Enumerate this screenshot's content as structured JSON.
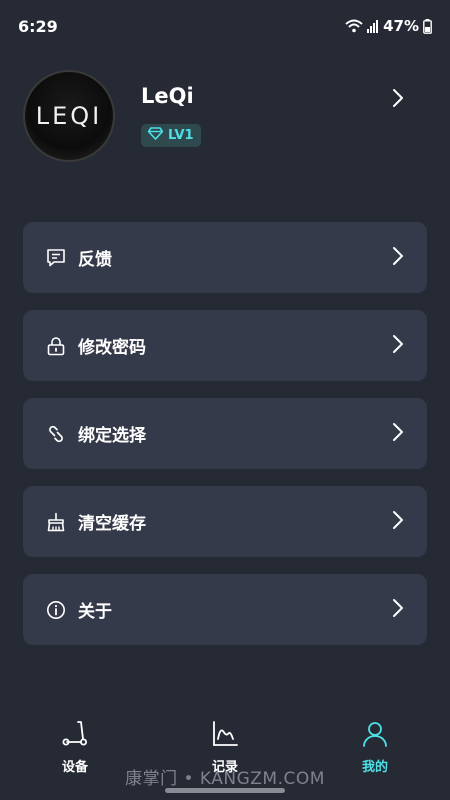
{
  "status_bar": {
    "time": "6:29",
    "battery": "47%"
  },
  "profile": {
    "avatar_text": "LEQI",
    "name": "LeQi",
    "level": "LV1"
  },
  "menu": [
    {
      "label": "反馈",
      "icon": "feedback-icon"
    },
    {
      "label": "修改密码",
      "icon": "lock-icon"
    },
    {
      "label": "绑定选择",
      "icon": "link-icon"
    },
    {
      "label": "清空缓存",
      "icon": "broom-icon"
    },
    {
      "label": "关于",
      "icon": "info-icon"
    }
  ],
  "nav": {
    "tabs": [
      {
        "label": "设备",
        "icon": "scooter-icon",
        "active": false
      },
      {
        "label": "记录",
        "icon": "chart-icon",
        "active": false
      },
      {
        "label": "我的",
        "icon": "person-icon",
        "active": true
      }
    ]
  },
  "watermark": "康掌门 • KANGZM.COM",
  "colors": {
    "background": "#262a35",
    "card": "#353a4a",
    "accent": "#4de0e6"
  }
}
